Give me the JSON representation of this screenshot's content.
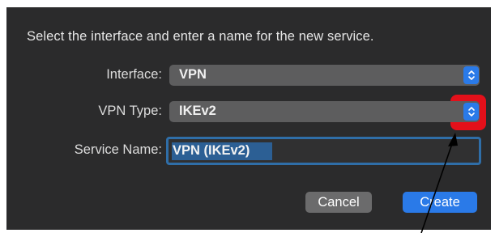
{
  "dialog": {
    "instruction": "Select the interface and enter a name for the new service."
  },
  "interface": {
    "label": "Interface:",
    "value": "VPN"
  },
  "vpn_type": {
    "label": "VPN Type:",
    "value": "IKEv2"
  },
  "service_name": {
    "label": "Service Name:",
    "value": "VPN (IKEv2)"
  },
  "buttons": {
    "cancel": "Cancel",
    "create": "Create"
  },
  "icons": {
    "stepper": "up-down-chevron-icon",
    "annotation": "arrow-annotation"
  },
  "colors": {
    "accent": "#2a7ae8",
    "highlight": "#e3101a",
    "dialog_bg": "#2b2b2c"
  }
}
